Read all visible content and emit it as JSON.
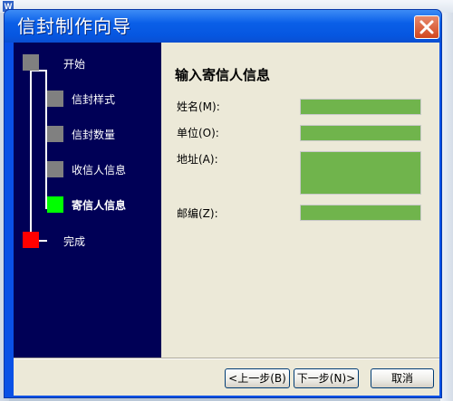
{
  "background": {
    "app_icon_letter": "W"
  },
  "window": {
    "title": "信封制作向导",
    "close_label": "✕"
  },
  "nav": {
    "steps": [
      {
        "label": "开始",
        "state": "done"
      },
      {
        "label": "信封样式",
        "state": "done"
      },
      {
        "label": "信封数量",
        "state": "done"
      },
      {
        "label": "收信人信息",
        "state": "done"
      },
      {
        "label": "寄信人信息",
        "state": "current"
      },
      {
        "label": "完成",
        "state": "end"
      }
    ]
  },
  "form": {
    "heading": "输入寄信人信息",
    "fields": [
      {
        "label": "姓名(M):",
        "value": ""
      },
      {
        "label": "单位(O):",
        "value": ""
      },
      {
        "label": "地址(A):",
        "value": ""
      },
      {
        "label": "邮编(Z):",
        "value": ""
      }
    ]
  },
  "buttons": {
    "back": "<上一步(B)",
    "next": "下一步(N)>",
    "cancel": "取消"
  },
  "colors": {
    "nav_bg": "#000056",
    "current_step": "#00ff00",
    "done_step": "#808080",
    "end_step": "#ff0000",
    "input_fill": "#70b44c",
    "titlebar": "#0a5fe8"
  }
}
